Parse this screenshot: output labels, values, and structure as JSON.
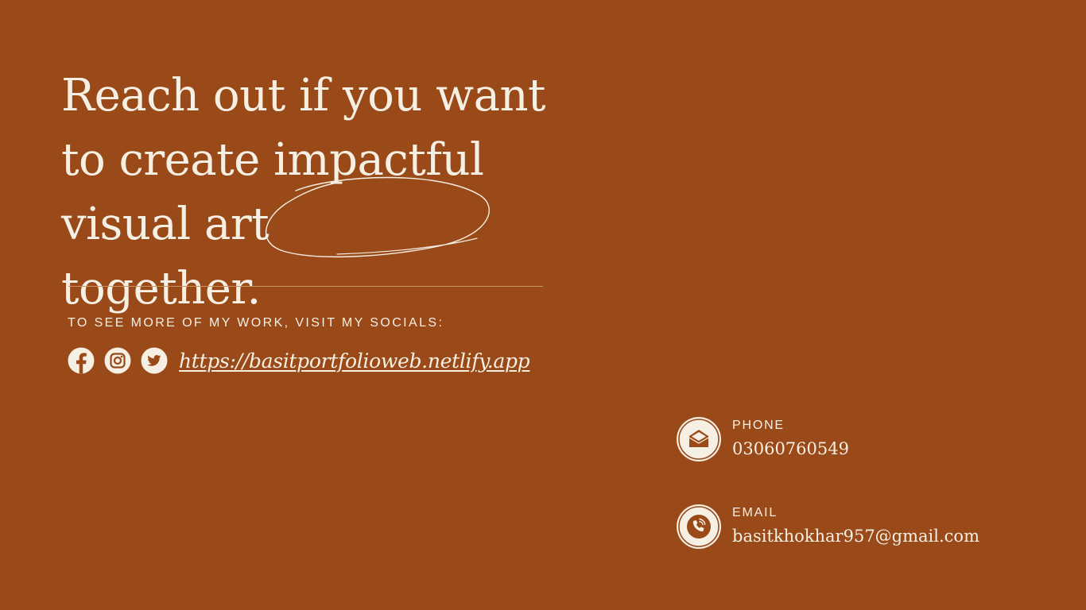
{
  "headline": {
    "line1": "Reach out if you want",
    "line2": "to create impactful",
    "line3_prefix": "visual art ",
    "line3_highlight": "together."
  },
  "socials": {
    "label": "TO SEE MORE OF MY WORK, VISIT MY SOCIALS:",
    "icons": [
      "facebook-icon",
      "instagram-icon",
      "twitter-icon"
    ],
    "link_text": "https://basitportfolioweb.netlify.app"
  },
  "contacts": {
    "phone": {
      "label": "PHONE",
      "value": "03060760549",
      "icon": "envelope-icon"
    },
    "email": {
      "label": "EMAIL",
      "value": "basitkhokhar957@gmail.com",
      "icon": "phone-icon"
    }
  },
  "colors": {
    "background": "#9a4918",
    "text": "#f6efe3",
    "divider": "#c9955f"
  }
}
